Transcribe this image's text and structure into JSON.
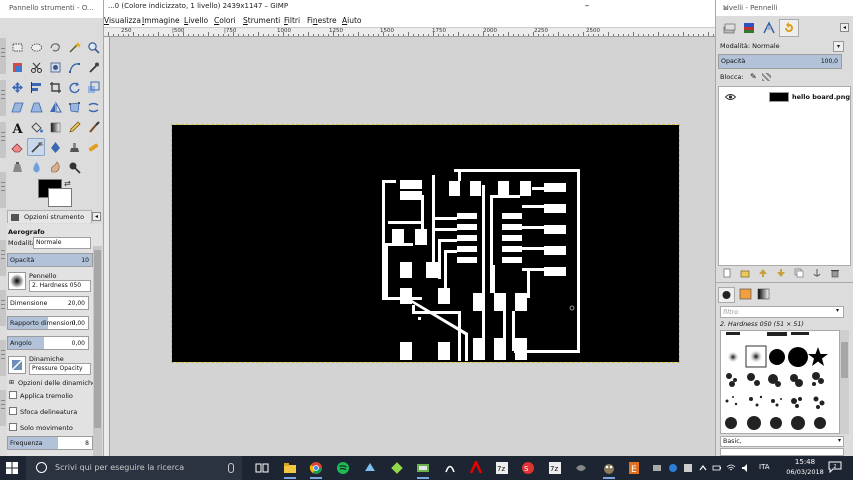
{
  "colors": {
    "selection": "#b2c3d9",
    "taskbar": "#1d2532",
    "canvas_bg": "#d3d3d3",
    "image_bg": "#000000",
    "traces": "#ffffff"
  },
  "toolbox": {
    "title": "Pannello strumenti - O...",
    "tools": [
      "rect-select-icon",
      "ellipse-select-icon",
      "lasso-icon",
      "wand-icon",
      "zoom-icon",
      "color-select-icon",
      "scissors-icon",
      "foreground-select-icon",
      "paths-icon",
      "color-picker-icon",
      "move-icon",
      "align-icon",
      "crop-icon",
      "rotate-icon",
      "scale-icon",
      "shear-icon",
      "perspective-icon",
      "flip-icon",
      "cage-icon",
      "warp-icon",
      "text-icon",
      "bucket-fill-icon",
      "blend-icon",
      "pencil-icon",
      "paintbrush-icon",
      "eraser-icon",
      "airbrush-icon",
      "ink-icon",
      "clone-icon",
      "heal-icon",
      "perspective-clone-icon",
      "blur-icon",
      "smudge-icon",
      "dodge-burn-icon"
    ],
    "active_tool_index": 26
  },
  "tool_options": {
    "tab_label": "Opzioni strumento",
    "tool_name": "Aerografo",
    "mode_label": "Modalità",
    "mode_value": "Normale",
    "opacity": {
      "label": "Opacità",
      "value": "10",
      "fraction": 1.0
    },
    "brush_label": "Pennello",
    "brush_value": "2. Hardness 050",
    "size": {
      "label": "Dimensione",
      "value": "20,00",
      "fraction": 0.0
    },
    "aspect": {
      "label": "Rapporto dimensioni",
      "value": "0,00",
      "fraction": 0.5
    },
    "angle": {
      "label": "Angolo",
      "value": "0,00",
      "fraction": 0.45
    },
    "dynamics_label": "Dinamiche",
    "dynamics_value": "Pressure Opacity",
    "dynamics_options": "Opzioni delle dinamiche",
    "apply_jitter": "Applica tremolio",
    "smooth_stroke": "Sfoca delineatura",
    "lock_brush": "Solo movimento",
    "rate": {
      "label": "Frequenza",
      "value": "8"
    }
  },
  "image_window": {
    "title": "...0 (Colore indicizzato, 1 livello) 2439x1147 – GIMP",
    "minimize": "–",
    "menus": [
      {
        "pre": "",
        "u": "V",
        "post": "isualizza"
      },
      {
        "pre": "",
        "u": "I",
        "post": "mmagine"
      },
      {
        "pre": "",
        "u": "L",
        "post": "ivello"
      },
      {
        "pre": "",
        "u": "C",
        "post": "olori"
      },
      {
        "pre": "",
        "u": "S",
        "post": "trumenti"
      },
      {
        "pre": "",
        "u": "F",
        "post": "iltri"
      },
      {
        "pre": "Fi",
        "u": "n",
        "post": "estre"
      },
      {
        "pre": "",
        "u": "A",
        "post": "iuto"
      }
    ],
    "ruler_ticks": [
      "250",
      "|500",
      "|750",
      "1000",
      "1250",
      "1500",
      "1750",
      "2000",
      "2250",
      "2500"
    ]
  },
  "dock": {
    "title": "Livelli - Pennelli",
    "close": "×",
    "mode_label": "Modalità:",
    "mode_value": "Normale",
    "opacity_label": "Opacità",
    "opacity_value": "100,0",
    "opacity_fraction": 1.0,
    "lock_label": "Blocca:",
    "layer_name": "hello board.png",
    "filter_placeholder": "filtro",
    "brush_name": "2. Hardness 050 (51 × 51)",
    "tag": "Basic,"
  },
  "taskbar": {
    "search_placeholder": "Scrivi qui per eseguire la ricerca",
    "lang": "ITA",
    "time": "15:48",
    "date": "06/03/2018",
    "notifications": "2"
  }
}
